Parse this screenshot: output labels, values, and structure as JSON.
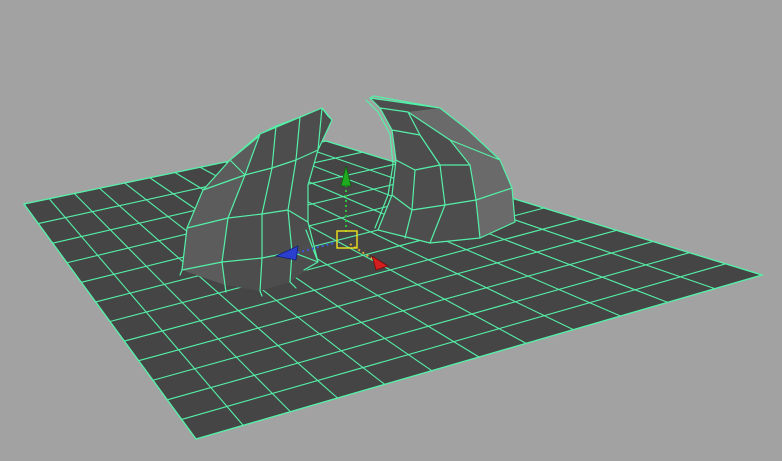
{
  "viewport": {
    "background": "#a2a2a2",
    "wire_color": "#55f0a8",
    "plane_fill": "#454545",
    "mesh_shade_dark": "#4d4d4d",
    "mesh_shade_mid": "#5c5c5c",
    "mesh_shade_light": "#6a6a6a",
    "grid_subdivisions": 12
  },
  "objects": [
    {
      "name": "ground-plane",
      "type": "polygon-plane",
      "selected": true
    },
    {
      "name": "left-horn",
      "type": "extruded-mesh",
      "selected": true
    },
    {
      "name": "right-horn",
      "type": "extruded-mesh",
      "selected": true
    }
  ],
  "manipulator": {
    "tool": "move",
    "axes": [
      {
        "axis": "y",
        "color": "#1faa1f",
        "icon": "arrow-up-icon"
      },
      {
        "axis": "x",
        "color": "#d21e1e",
        "icon": "arrow-right-icon"
      },
      {
        "axis": "z",
        "color": "#2a3fd0",
        "icon": "arrow-left-icon"
      }
    ],
    "center_color": "#f2e21a"
  }
}
